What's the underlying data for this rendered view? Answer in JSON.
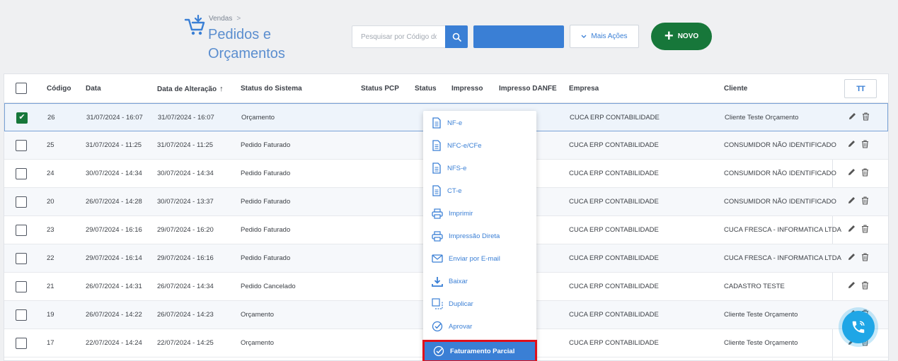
{
  "header": {
    "breadcrumb": "Vendas",
    "breadcrumb_sep": ">",
    "title_line1": "Pedidos e",
    "title_line2": "Orçamentos",
    "search_placeholder": "Pesquisar por Código do",
    "mais_acoes": "Mais Ações",
    "novo": "NOVO"
  },
  "table": {
    "columns": {
      "codigo": "Código",
      "data": "Data",
      "data_alteracao": "Data de Alteração",
      "status_sistema": "Status do Sistema",
      "status_pcp": "Status PCP",
      "status": "Status",
      "impresso": "Impresso",
      "impresso_danfe": "Impresso DANFE",
      "empresa": "Empresa",
      "cliente": "Cliente"
    },
    "sort_arrow": "↑",
    "columns_button": "TT",
    "rows": [
      {
        "codigo": "26",
        "data": "31/07/2024 - 16:07",
        "alteracao": "31/07/2024 - 16:07",
        "status": "Orçamento",
        "empresa": "CUCA ERP CONTABILIDADE",
        "cliente": "Cliente Teste Orçamento",
        "checked": true
      },
      {
        "codigo": "25",
        "data": "31/07/2024 - 11:25",
        "alteracao": "31/07/2024 - 11:25",
        "status": "Pedido Faturado",
        "empresa": "CUCA ERP CONTABILIDADE",
        "cliente": "CONSUMIDOR NÃO IDENTIFICADO",
        "checked": false
      },
      {
        "codigo": "24",
        "data": "30/07/2024 - 14:34",
        "alteracao": "30/07/2024 - 14:34",
        "status": "Pedido Faturado",
        "empresa": "CUCA ERP CONTABILIDADE",
        "cliente": "CONSUMIDOR NÃO IDENTIFICADO",
        "checked": false
      },
      {
        "codigo": "20",
        "data": "26/07/2024 - 14:28",
        "alteracao": "30/07/2024 - 13:37",
        "status": "Pedido Faturado",
        "empresa": "CUCA ERP CONTABILIDADE",
        "cliente": "CONSUMIDOR NÃO IDENTIFICADO",
        "checked": false
      },
      {
        "codigo": "23",
        "data": "29/07/2024 - 16:16",
        "alteracao": "29/07/2024 - 16:20",
        "status": "Pedido Faturado",
        "empresa": "CUCA ERP CONTABILIDADE",
        "cliente": "CUCA FRESCA - INFORMATICA LTDA",
        "checked": false
      },
      {
        "codigo": "22",
        "data": "29/07/2024 - 16:14",
        "alteracao": "29/07/2024 - 16:16",
        "status": "Pedido Faturado",
        "empresa": "CUCA ERP CONTABILIDADE",
        "cliente": "CUCA FRESCA - INFORMATICA LTDA",
        "checked": false
      },
      {
        "codigo": "21",
        "data": "26/07/2024 - 14:31",
        "alteracao": "26/07/2024 - 14:34",
        "status": "Pedido Cancelado",
        "empresa": "CUCA ERP CONTABILIDADE",
        "cliente": "CADASTRO TESTE",
        "checked": false
      },
      {
        "codigo": "19",
        "data": "26/07/2024 - 14:22",
        "alteracao": "26/07/2024 - 14:23",
        "status": "Orçamento",
        "empresa": "CUCA ERP CONTABILIDADE",
        "cliente": "Cliente Teste Orçamento",
        "checked": false
      },
      {
        "codigo": "17",
        "data": "22/07/2024 - 14:24",
        "alteracao": "22/07/2024 - 14:25",
        "status": "Orçamento",
        "empresa": "CUCA ERP CONTABILIDADE",
        "cliente": "Cliente Teste Orçamento",
        "checked": false
      }
    ]
  },
  "context_menu": {
    "items": [
      {
        "label": "NF-e",
        "icon": "document-icon"
      },
      {
        "label": "NFC-e/CFe",
        "icon": "document-icon"
      },
      {
        "label": "NFS-e",
        "icon": "document-icon"
      },
      {
        "label": "CT-e",
        "icon": "document-icon"
      },
      {
        "label": "Imprimir",
        "icon": "printer-icon"
      },
      {
        "label": "Impressão Direta",
        "icon": "printer-icon"
      },
      {
        "label": "Enviar por E-mail",
        "icon": "envelope-icon"
      },
      {
        "label": "Baixar",
        "icon": "download-icon"
      },
      {
        "label": "Duplicar",
        "icon": "duplicate-icon"
      },
      {
        "label": "Aprovar",
        "icon": "check-circle-icon"
      },
      {
        "label": "Faturamento Parcial",
        "icon": "check-circle-icon",
        "highlighted": true
      }
    ]
  },
  "colors": {
    "accent": "#3a7fd5",
    "novo": "#17773a",
    "highlight_border": "#e0101b",
    "phone": "#1fa6e6"
  }
}
